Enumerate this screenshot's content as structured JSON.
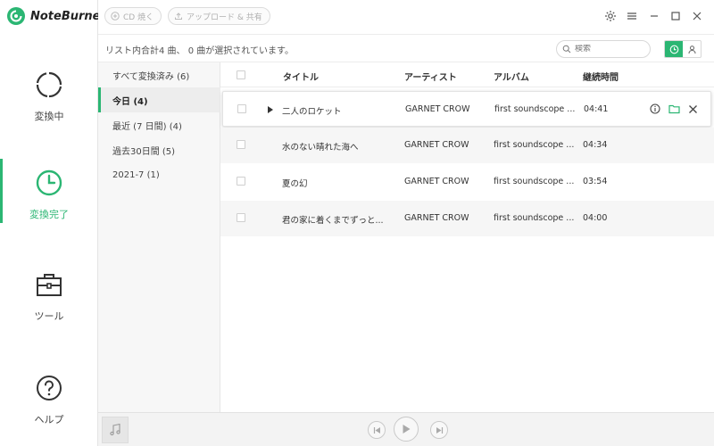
{
  "app": {
    "name": "NoteBurner"
  },
  "toolbar": {
    "burn_cd": "CD 焼く",
    "upload_share": "アップロード & 共有"
  },
  "nav": [
    {
      "label": "変換中",
      "icon": "converting-icon"
    },
    {
      "label": "変換完了",
      "icon": "clock-icon",
      "active": true
    },
    {
      "label": "ツール",
      "icon": "toolbox-icon"
    },
    {
      "label": "ヘルプ",
      "icon": "help-icon"
    }
  ],
  "status": {
    "text": "リスト内合計4 曲、 0 曲が選択されています。"
  },
  "search": {
    "placeholder": "検索"
  },
  "categories": [
    {
      "label": "すべて変換済み (6)"
    },
    {
      "label": "今日 (4)",
      "active": true
    },
    {
      "label": "最近 (7 日間) (4)"
    },
    {
      "label": "過去30日間 (5)"
    },
    {
      "label": "2021-7 (1)"
    }
  ],
  "table": {
    "headers": {
      "title": "タイトル",
      "artist": "アーティスト",
      "album": "アルバム",
      "duration": "継続時間"
    },
    "rows": [
      {
        "title": "二人のロケット",
        "artist": "GARNET CROW",
        "album": "first soundscope ...",
        "duration": "04:41"
      },
      {
        "title": "水のない晴れた海へ",
        "artist": "GARNET CROW",
        "album": "first soundscope ...",
        "duration": "04:34"
      },
      {
        "title": "夏の幻",
        "artist": "GARNET CROW",
        "album": "first soundscope ...",
        "duration": "03:54"
      },
      {
        "title": "君の家に着くまでずっと...",
        "artist": "GARNET CROW",
        "album": "first soundscope ...",
        "duration": "04:00"
      }
    ]
  },
  "colors": {
    "accent": "#2bb673"
  }
}
